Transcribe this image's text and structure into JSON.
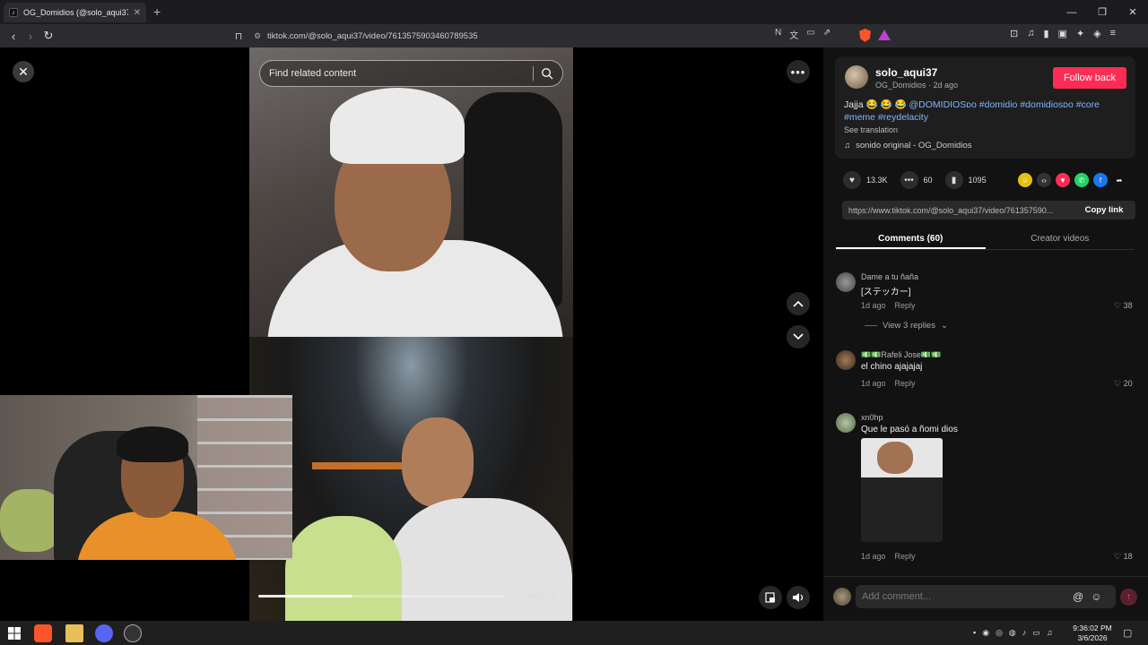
{
  "browser": {
    "tab_title": "OG_Domidios (@solo_aqui37",
    "tab_close": "✕",
    "new_tab": "+",
    "url": "tiktok.com/@solo_aqui37/video/7613575903460789535",
    "window_controls": [
      "—",
      "❐",
      "✕"
    ]
  },
  "search": {
    "placeholder": "Find related content"
  },
  "player": {
    "timecode": "00:09/00:24",
    "progress": 0.38
  },
  "video_info": {
    "username": "solo_aqui37",
    "subline": "OG_Domidios · 2d ago",
    "follow_label": "Follow back",
    "caption_prefix": "Jajja 😂 😂 😂 ",
    "caption_tags": "@DOMIDIOSᴅᴏ #domidio #domidiosᴅᴏ #core #meme #reydelacity",
    "see_translation": "See translation",
    "sound": "sonido original - OG_Domidios"
  },
  "stats": {
    "likes": "13.3K",
    "comments": "60",
    "saves": "1095"
  },
  "share_link": {
    "url": "https://www.tiktok.com/@solo_aqui37/video/761357590...",
    "copy_label": "Copy link"
  },
  "tabs": {
    "comments": "Comments (60)",
    "creator": "Creator videos"
  },
  "comments": [
    {
      "name": "Dame a tu ñaña",
      "text": "[ステッカー]",
      "time": "1d ago",
      "reply": "Reply",
      "likes": "38"
    },
    {
      "name": "💵💵Rafeli Jose💵💵",
      "text": "el chino ajajajaj",
      "time": "1d ago",
      "reply": "Reply",
      "likes": "20"
    },
    {
      "name": "xn0hp",
      "text": "Que le pasó a ñomi dios",
      "time": "1d ago",
      "reply": "Reply",
      "likes": "18"
    }
  ],
  "view_replies": "View 3 replies",
  "add_comment": {
    "placeholder": "Add comment..."
  },
  "taskbar": {
    "time": "9:36:02 PM",
    "date": "3/6/2026"
  },
  "colors": {
    "follow": "#fe2c55",
    "hashtag": "#7fb5ff",
    "brave": "#fb542b"
  }
}
